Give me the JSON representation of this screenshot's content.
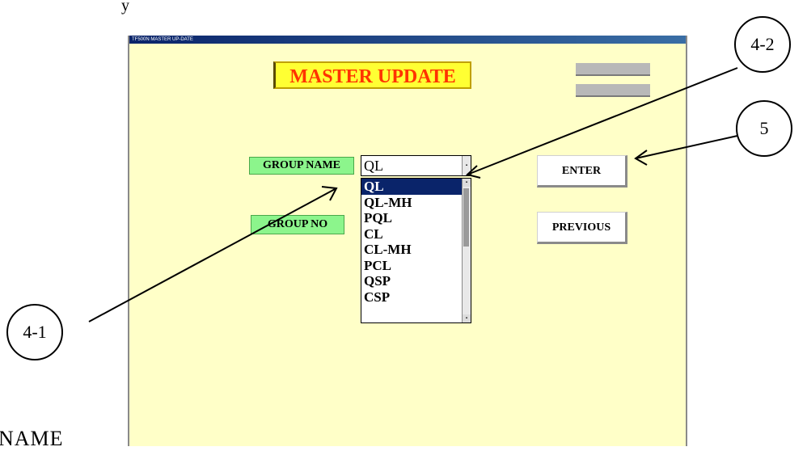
{
  "top_fragment": "y",
  "bottom_fragment": "NAME",
  "window": {
    "title": "TF500N MASTER UP-DATE",
    "heading": "MASTER UPDATE",
    "gray_buttons": [
      "",
      ""
    ],
    "group_name_label": "GROUP NAME",
    "group_no_label": "GROUP NO",
    "combo_value": "QL",
    "list_items": [
      "QL",
      "QL-MH",
      "PQL",
      "CL",
      "CL-MH",
      "PCL",
      "QSP",
      "CSP"
    ],
    "enter_label": "ENTER",
    "previous_label": "PREVIOUS"
  },
  "callouts": {
    "c41": "4-1",
    "c42": "4-2",
    "c5": "5"
  },
  "colors": {
    "window_bg": "#ffffc8",
    "title_bg": "#ffff33",
    "title_text": "#ff3300",
    "label_green": "#8cf58c",
    "selection": "#0a246a"
  }
}
